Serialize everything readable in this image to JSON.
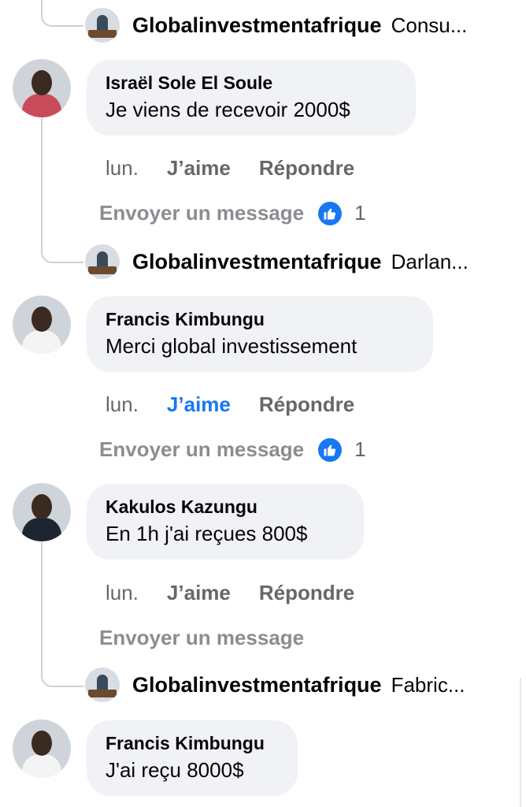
{
  "thread": {
    "replies": [
      {
        "name": "Globalinvestmentafrique",
        "text": "Consu..."
      },
      {
        "name": "Globalinvestmentafrique",
        "text": "Darlan..."
      },
      {
        "name": "Globalinvestmentafrique",
        "text": "Fabric..."
      }
    ],
    "comments": [
      {
        "author": "Israël Sole El Soule",
        "text": "Je viens de recevoir 2000$",
        "time": "lun.",
        "like_label": "J’aime",
        "like_active": false,
        "reply_label": "Répondre",
        "send_label": "Envoyer un message",
        "reaction_count": "1"
      },
      {
        "author": "Francis Kimbungu",
        "text": "Merci global investissement",
        "time": "lun.",
        "like_label": "J’aime",
        "like_active": true,
        "reply_label": "Répondre",
        "send_label": "Envoyer un message",
        "reaction_count": "1"
      },
      {
        "author": "Kakulos Kazungu",
        "text": "En 1h j'ai reçues 800$",
        "time": "lun.",
        "like_label": "J’aime",
        "like_active": false,
        "reply_label": "Répondre",
        "send_label": "Envoyer un message",
        "reaction_count": ""
      },
      {
        "author": "Francis Kimbungu",
        "text": "J'ai reçu 8000$"
      }
    ]
  },
  "colors": {
    "like_blue": "#1877f2",
    "bubble_bg": "#f0f2f5",
    "muted_text": "#65676b"
  },
  "icons": {
    "reaction": "thumbs-up-icon"
  }
}
